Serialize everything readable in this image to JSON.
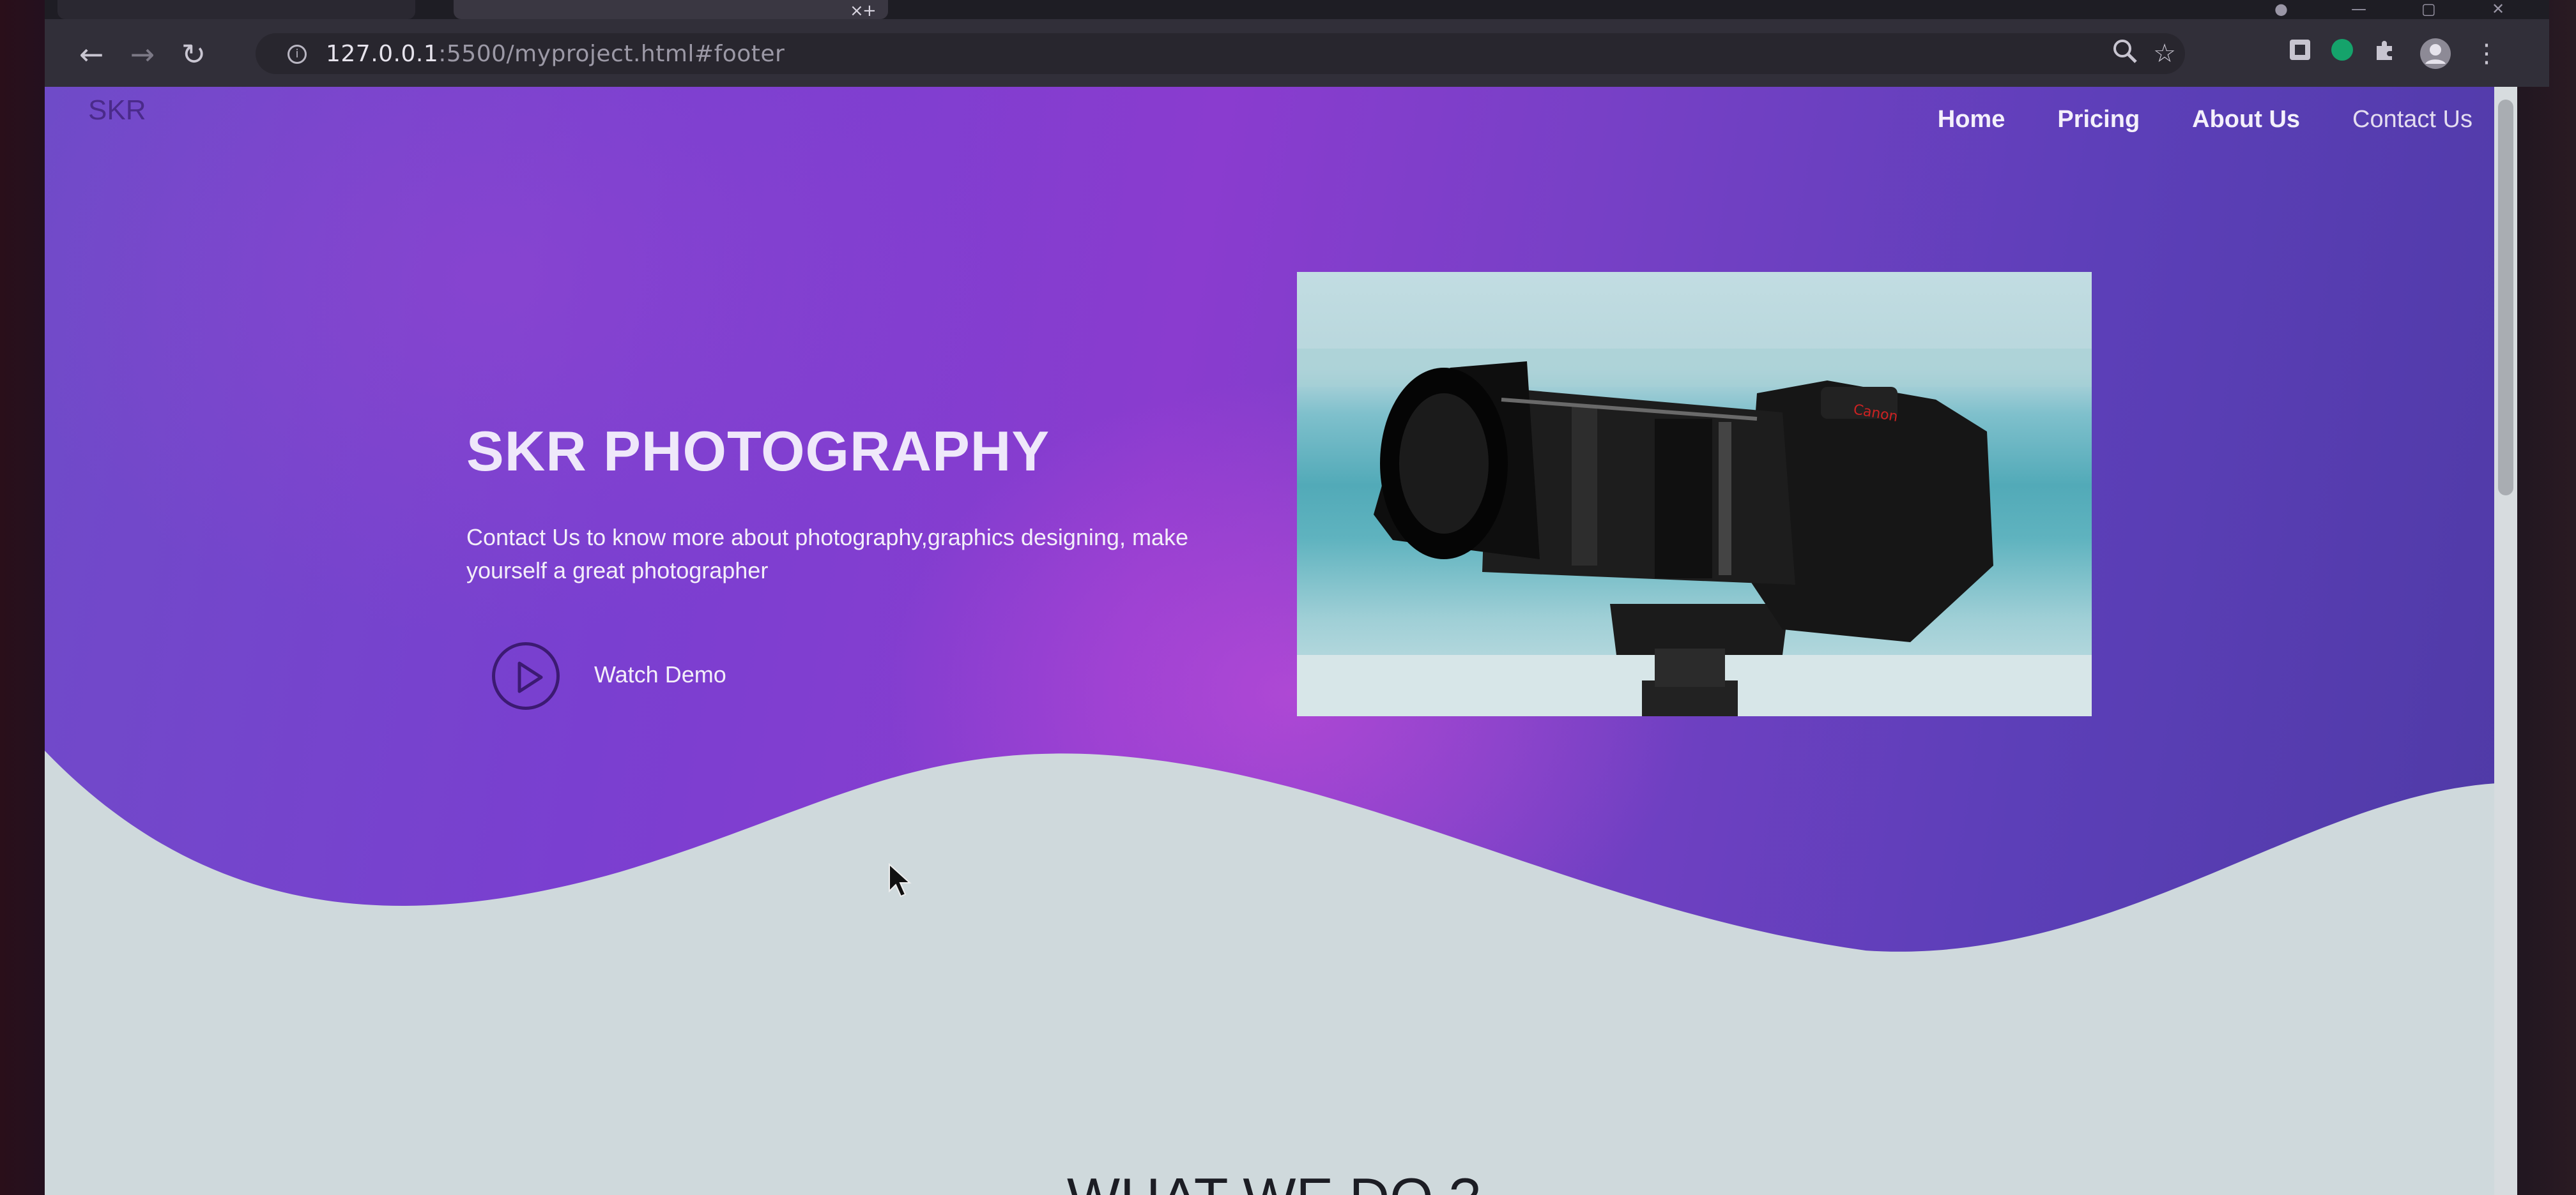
{
  "browser": {
    "url_host": "127.0.0.1",
    "url_rest": ":5500/myproject.html#footer",
    "tab_close": "×",
    "new_tab": "+"
  },
  "site": {
    "logo": "SKR",
    "nav": [
      "Home",
      "Pricing",
      "About Us",
      "Contact Us"
    ]
  },
  "hero": {
    "title": "SKR PHOTOGRAPHY",
    "subtitle": "Contact Us to know more about photography,graphics designing, make yourself a great photographer",
    "cta_label": "Watch Demo"
  },
  "section": {
    "heading": "WHAT WE DO ?"
  },
  "colors": {
    "hero_purple": "#7a3fd0",
    "page_background": "#cfd9dc",
    "play_ring": "#3c1a72"
  }
}
